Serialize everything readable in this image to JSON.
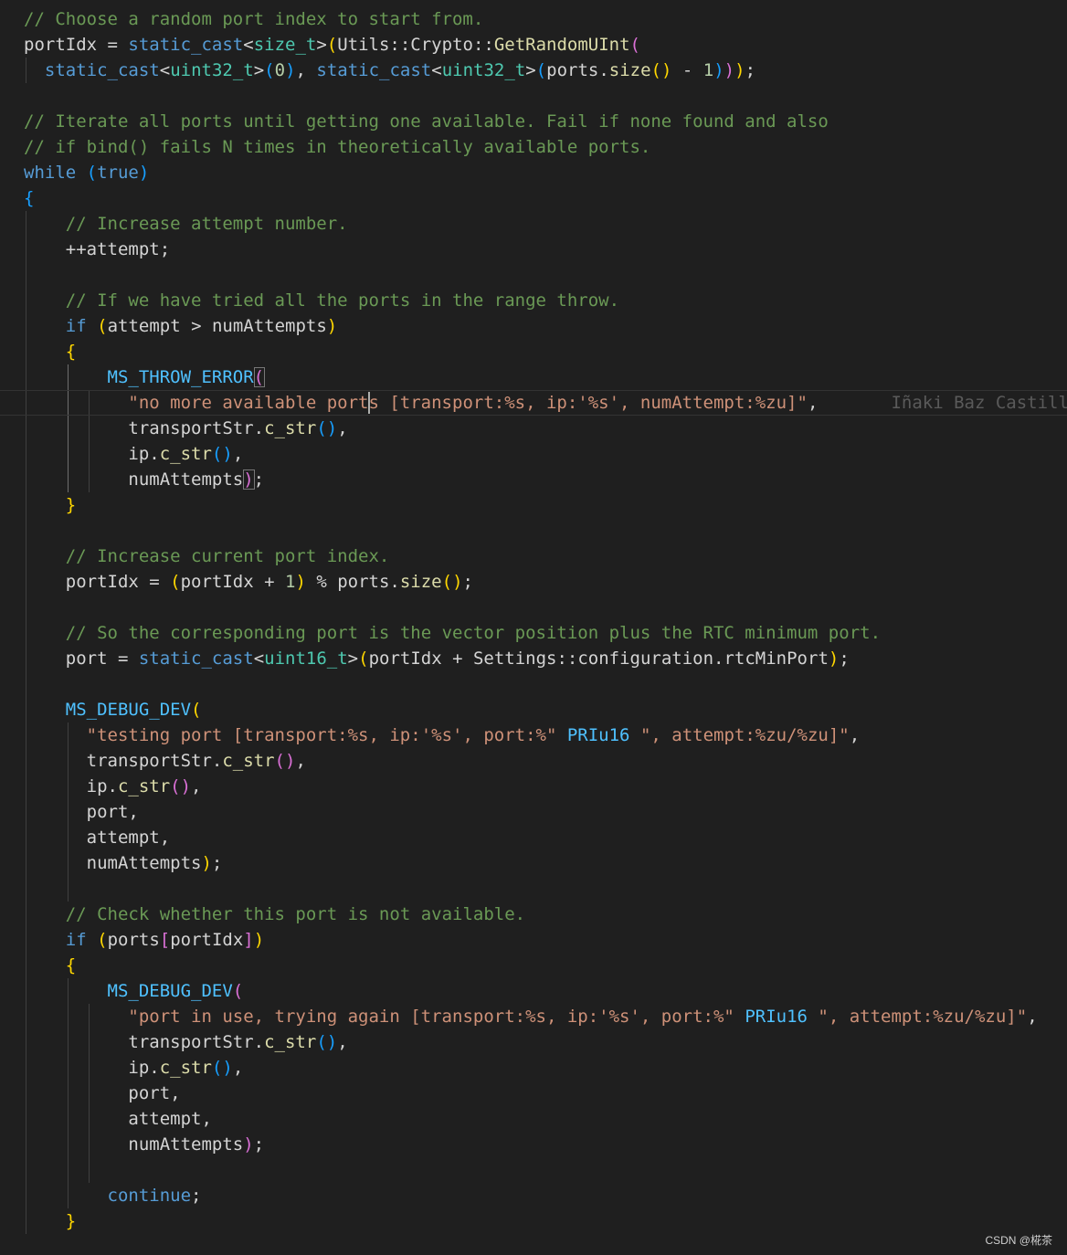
{
  "colors": {
    "background": "#1f1f1f",
    "comment": "#6a9955",
    "keyword": "#569cd6",
    "macro": "#4fc1ff",
    "string": "#ce9178",
    "number": "#b5cea8",
    "type": "#4ec9b0",
    "function": "#dcdcaa",
    "identifier": "#d4d4d4",
    "bracket_level_1": "#ffd700",
    "bracket_level_2": "#da70d6",
    "bracket_level_3": "#179fff"
  },
  "code_lines": [
    [
      [
        "c",
        "// Choose a random port index to start from."
      ]
    ],
    [
      [
        "v",
        "portIdx = "
      ],
      [
        "k",
        "static_cast"
      ],
      [
        "v",
        "<"
      ],
      [
        "t",
        "size_t"
      ],
      [
        "v",
        ">"
      ],
      [
        "b1",
        "("
      ],
      [
        "v",
        "Utils::Crypto::"
      ],
      [
        "f",
        "GetRandomUInt"
      ],
      [
        "b2",
        "("
      ]
    ],
    [
      [
        "v",
        "  "
      ],
      [
        "k",
        "static_cast"
      ],
      [
        "v",
        "<"
      ],
      [
        "t",
        "uint32_t"
      ],
      [
        "v",
        ">"
      ],
      [
        "b3",
        "("
      ],
      [
        "n",
        "0"
      ],
      [
        "b3",
        ")"
      ],
      [
        "v",
        ", "
      ],
      [
        "k",
        "static_cast"
      ],
      [
        "v",
        "<"
      ],
      [
        "t",
        "uint32_t"
      ],
      [
        "v",
        ">"
      ],
      [
        "b3",
        "("
      ],
      [
        "v",
        "ports."
      ],
      [
        "f",
        "size"
      ],
      [
        "b1",
        "()"
      ],
      [
        "v",
        " - "
      ],
      [
        "n",
        "1"
      ],
      [
        "b3",
        ")"
      ],
      [
        "b2",
        ")"
      ],
      [
        "b1",
        ")"
      ],
      [
        "v",
        ";"
      ]
    ],
    [],
    [
      [
        "c",
        "// Iterate all ports until getting one available. Fail if none found and also"
      ]
    ],
    [
      [
        "c",
        "// if bind() fails N times in theoretically available ports."
      ]
    ],
    [
      [
        "k",
        "while"
      ],
      [
        "v",
        " "
      ],
      [
        "b3",
        "("
      ],
      [
        "k",
        "true"
      ],
      [
        "b3",
        ")"
      ]
    ],
    [
      [
        "b3",
        "{"
      ]
    ],
    [
      [
        "v",
        "    "
      ],
      [
        "c",
        "// Increase attempt number."
      ]
    ],
    [
      [
        "v",
        "    ++attempt;"
      ]
    ],
    [],
    [
      [
        "v",
        "    "
      ],
      [
        "c",
        "// If we have tried all the ports in the range throw."
      ]
    ],
    [
      [
        "v",
        "    "
      ],
      [
        "k",
        "if"
      ],
      [
        "v",
        " "
      ],
      [
        "b1",
        "("
      ],
      [
        "v",
        "attempt > numAttempts"
      ],
      [
        "b1",
        ")"
      ]
    ],
    [
      [
        "v",
        "    "
      ],
      [
        "b1",
        "{"
      ]
    ],
    [
      [
        "v",
        "        "
      ],
      [
        "mc",
        "MS_THROW_ERROR"
      ],
      [
        "b2",
        "("
      ]
    ],
    [
      [
        "v",
        "          "
      ],
      [
        "s",
        "\"no more available ports [transport:%s, ip:'%s', numAttempt:%zu]\""
      ],
      [
        "v",
        ","
      ]
    ],
    [
      [
        "v",
        "          transportStr."
      ],
      [
        "f",
        "c_str"
      ],
      [
        "b3",
        "()"
      ],
      [
        "v",
        ","
      ]
    ],
    [
      [
        "v",
        "          ip."
      ],
      [
        "f",
        "c_str"
      ],
      [
        "b3",
        "()"
      ],
      [
        "v",
        ","
      ]
    ],
    [
      [
        "v",
        "          numAttempts"
      ],
      [
        "b2",
        ")"
      ],
      [
        "v",
        ";"
      ]
    ],
    [
      [
        "v",
        "    "
      ],
      [
        "b1",
        "}"
      ]
    ],
    [],
    [
      [
        "v",
        "    "
      ],
      [
        "c",
        "// Increase current port index."
      ]
    ],
    [
      [
        "v",
        "    portIdx = "
      ],
      [
        "b1",
        "("
      ],
      [
        "v",
        "portIdx + "
      ],
      [
        "n",
        "1"
      ],
      [
        "b1",
        ")"
      ],
      [
        "v",
        " % ports."
      ],
      [
        "f",
        "size"
      ],
      [
        "b1",
        "()"
      ],
      [
        "v",
        ";"
      ]
    ],
    [],
    [
      [
        "v",
        "    "
      ],
      [
        "c",
        "// So the corresponding port is the vector position plus the RTC minimum port."
      ]
    ],
    [
      [
        "v",
        "    port = "
      ],
      [
        "k",
        "static_cast"
      ],
      [
        "v",
        "<"
      ],
      [
        "t",
        "uint16_t"
      ],
      [
        "v",
        ">"
      ],
      [
        "b1",
        "("
      ],
      [
        "v",
        "portIdx + Settings::configuration.rtcMinPort"
      ],
      [
        "b1",
        ")"
      ],
      [
        "v",
        ";"
      ]
    ],
    [],
    [
      [
        "v",
        "    "
      ],
      [
        "mc",
        "MS_DEBUG_DEV"
      ],
      [
        "b1",
        "("
      ]
    ],
    [
      [
        "v",
        "      "
      ],
      [
        "s",
        "\"testing port [transport:%s, ip:'%s', port:%\""
      ],
      [
        "v",
        " "
      ],
      [
        "mc",
        "PRIu16"
      ],
      [
        "v",
        " "
      ],
      [
        "s",
        "\", attempt:%zu/%zu]\""
      ],
      [
        "v",
        ","
      ]
    ],
    [
      [
        "v",
        "      transportStr."
      ],
      [
        "f",
        "c_str"
      ],
      [
        "b2",
        "()"
      ],
      [
        "v",
        ","
      ]
    ],
    [
      [
        "v",
        "      ip."
      ],
      [
        "f",
        "c_str"
      ],
      [
        "b2",
        "()"
      ],
      [
        "v",
        ","
      ]
    ],
    [
      [
        "v",
        "      port,"
      ]
    ],
    [
      [
        "v",
        "      attempt,"
      ]
    ],
    [
      [
        "v",
        "      numAttempts"
      ],
      [
        "b1",
        ")"
      ],
      [
        "v",
        ";"
      ]
    ],
    [],
    [
      [
        "v",
        "    "
      ],
      [
        "c",
        "// Check whether this port is not available."
      ]
    ],
    [
      [
        "v",
        "    "
      ],
      [
        "k",
        "if"
      ],
      [
        "v",
        " "
      ],
      [
        "b1",
        "("
      ],
      [
        "v",
        "ports"
      ],
      [
        "b2",
        "["
      ],
      [
        "v",
        "portIdx"
      ],
      [
        "b2",
        "]"
      ],
      [
        "b1",
        ")"
      ]
    ],
    [
      [
        "v",
        "    "
      ],
      [
        "b1",
        "{"
      ]
    ],
    [
      [
        "v",
        "        "
      ],
      [
        "mc",
        "MS_DEBUG_DEV"
      ],
      [
        "b2",
        "("
      ]
    ],
    [
      [
        "v",
        "          "
      ],
      [
        "s",
        "\"port in use, trying again [transport:%s, ip:'%s', port:%\""
      ],
      [
        "v",
        " "
      ],
      [
        "mc",
        "PRIu16"
      ],
      [
        "v",
        " "
      ],
      [
        "s",
        "\", attempt:%zu/%zu]\""
      ],
      [
        "v",
        ","
      ]
    ],
    [
      [
        "v",
        "          transportStr."
      ],
      [
        "f",
        "c_str"
      ],
      [
        "b3",
        "()"
      ],
      [
        "v",
        ","
      ]
    ],
    [
      [
        "v",
        "          ip."
      ],
      [
        "f",
        "c_str"
      ],
      [
        "b3",
        "()"
      ],
      [
        "v",
        ","
      ]
    ],
    [
      [
        "v",
        "          port,"
      ]
    ],
    [
      [
        "v",
        "          attempt,"
      ]
    ],
    [
      [
        "v",
        "          numAttempts"
      ],
      [
        "b2",
        ")"
      ],
      [
        "v",
        ";"
      ]
    ],
    [],
    [
      [
        "v",
        "        "
      ],
      [
        "k",
        "continue"
      ],
      [
        "v",
        ";"
      ]
    ],
    [
      [
        "v",
        "    "
      ],
      [
        "b1",
        "}"
      ]
    ]
  ],
  "blame_annotation": "Iñaki Baz Castillo",
  "watermark": "CSDN @椛茶"
}
